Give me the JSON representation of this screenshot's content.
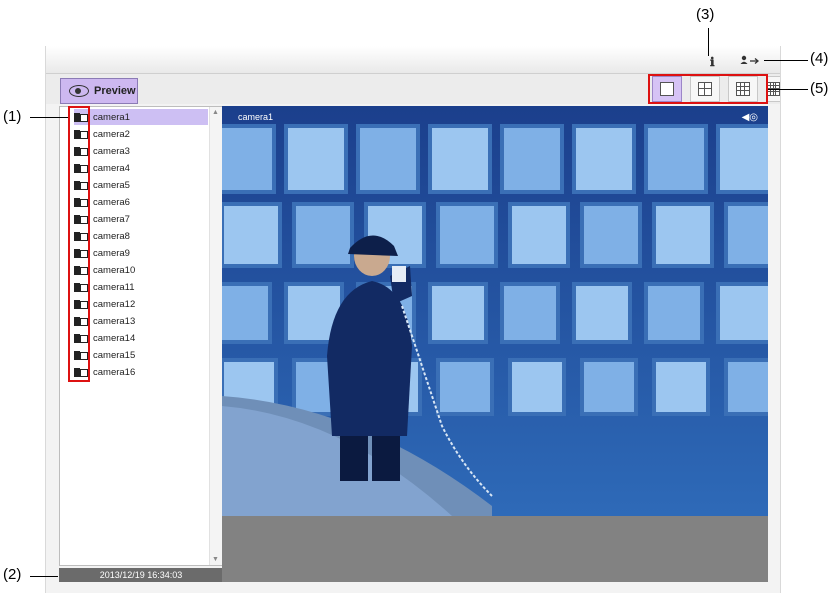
{
  "callouts": [
    "(1)",
    "(2)",
    "(3)",
    "(4)",
    "(5)"
  ],
  "toolbar": {
    "preview_label": "Preview"
  },
  "icons": {
    "preview": "eye-icon",
    "info": "info-icon",
    "logout": "logout-icon",
    "speaker": "speaker-icon"
  },
  "layouts": [
    "1x1",
    "2x2",
    "3x3",
    "4x4"
  ],
  "cameras": [
    "camera1",
    "camera2",
    "camera3",
    "camera4",
    "camera5",
    "camera6",
    "camera7",
    "camera8",
    "camera9",
    "camera10",
    "camera11",
    "camera12",
    "camera13",
    "camera14",
    "camera15",
    "camera16"
  ],
  "selected_camera": "camera1",
  "video": {
    "camera_label": "camera1"
  },
  "status": {
    "datetime": "2013/12/19 16:34:03"
  },
  "colors": {
    "accent": "#cdb8f0",
    "callout_box": "#dd1111",
    "video_blue": "#2f78c8"
  }
}
